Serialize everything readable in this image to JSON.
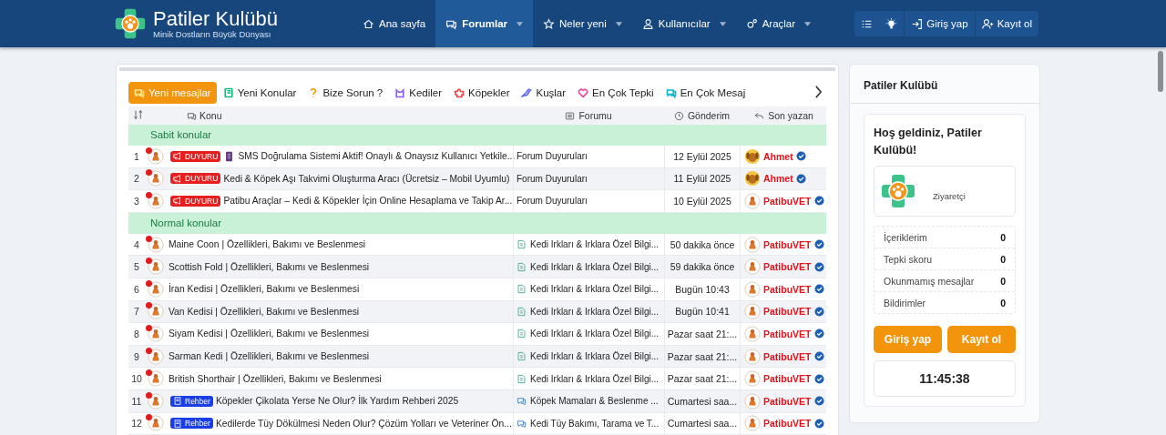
{
  "header": {
    "site_title": "Patiler Kulübü",
    "tagline": "Minik Dostların Büyük Dünyası",
    "nav": [
      {
        "label": "Ana sayfa",
        "selected": false,
        "dropdown": false
      },
      {
        "label": "Forumlar",
        "selected": true,
        "dropdown": true
      },
      {
        "label": "Neler yeni",
        "selected": false,
        "dropdown": true
      },
      {
        "label": "Kullanıcılar",
        "selected": false,
        "dropdown": true
      },
      {
        "label": "Araçlar",
        "selected": false,
        "dropdown": true
      }
    ],
    "actions": [
      "Giriş yap",
      "Kayıt ol"
    ]
  },
  "tabs": [
    {
      "label": "Yeni mesajlar",
      "color": "#fde68a",
      "selected": true
    },
    {
      "label": "Yeni Konular",
      "color": "#10b981",
      "selected": false
    },
    {
      "label": "Bize Sorun ?",
      "color": "#f59e0b",
      "selected": false
    },
    {
      "label": "Kediler",
      "color": "#8b5cf6",
      "selected": false
    },
    {
      "label": "Köpekler",
      "color": "#ef4444",
      "selected": false
    },
    {
      "label": "Kuşlar",
      "color": "#6366f1",
      "selected": false
    },
    {
      "label": "En Çok Tepki",
      "color": "#ec4899",
      "selected": false
    },
    {
      "label": "En Çok Mesaj",
      "color": "#06b6d4",
      "selected": false
    }
  ],
  "table": {
    "columns": [
      "Konu",
      "Forumu",
      "Gönderim",
      "Son yazan"
    ],
    "groups": [
      {
        "label": "Sabit konular",
        "rows": [
          {
            "kind": "announcement",
            "number": "1",
            "unread": true,
            "badge": {
              "kind": "duyuru",
              "label": "DUYURU"
            },
            "prefix_icon": true,
            "title": "SMS Doğrulama Sistemi Aktif! Onaylı & Onaysız Kullanıcı Yetkile...",
            "forum": "Forum Duyuruları",
            "date": "12 Eylül 2025",
            "author": "Ahmet",
            "avatar": {
              "kind": "dog"
            },
            "verified": true
          },
          {
            "kind": "announcement",
            "number": "2",
            "unread": true,
            "badge": {
              "kind": "duyuru",
              "label": "DUYURU"
            },
            "title": "Kedi & Köpek Aşı Takvimi Oluşturma Aracı (Ücretsiz – Mobil Uyumlu)",
            "forum": "Forum Duyuruları",
            "date": "11 Eylül 2025",
            "author": "Ahmet",
            "avatar": {
              "kind": "dog"
            },
            "verified": true
          },
          {
            "kind": "announcement",
            "number": "3",
            "unread": true,
            "badge": {
              "kind": "duyuru",
              "label": "DUYURU"
            },
            "title": "Patibu Araçlar – Kedi & Köpekler İçin Online Hesaplama ve Takip Ar...",
            "forum": "Forum Duyuruları",
            "date": "10 Eylül 2025",
            "author": "PatibuVET",
            "avatar": {
              "kind": "logo"
            },
            "verified": true
          }
        ]
      },
      {
        "label": "Normal konular",
        "rows": [
          {
            "kind": "article",
            "number": "4",
            "unread": true,
            "title": "Maine Coon | Özellikleri, Bakımı ve Beslenmesi",
            "forum": "Kedi Irkları & Irklara Özel Bilgi...",
            "date": "50 dakika önce",
            "author": "PatibuVET",
            "avatar": {
              "kind": "logo"
            },
            "verified": true
          },
          {
            "kind": "article",
            "number": "5",
            "unread": true,
            "title": "Scottish Fold | Özellikleri, Bakımı ve Beslenmesi",
            "forum": "Kedi Irkları & Irklara Özel Bilgi...",
            "date": "59 dakika önce",
            "author": "PatibuVET",
            "avatar": {
              "kind": "logo"
            },
            "verified": true
          },
          {
            "kind": "article",
            "number": "6",
            "unread": true,
            "title": "İran Kedisi | Özellikleri, Bakımı ve Beslenmesi",
            "forum": "Kedi Irkları & Irklara Özel Bilgi...",
            "date": "Bugün 10:43",
            "author": "PatibuVET",
            "avatar": {
              "kind": "logo"
            },
            "verified": true
          },
          {
            "kind": "article",
            "number": "7",
            "unread": true,
            "title": "Van Kedisi | Özellikleri, Bakımı ve Beslenmesi",
            "forum": "Kedi Irkları & Irklara Özel Bilgi...",
            "date": "Bugün 10:41",
            "author": "PatibuVET",
            "avatar": {
              "kind": "logo"
            },
            "verified": true
          },
          {
            "kind": "article",
            "number": "8",
            "unread": true,
            "title": "Siyam Kedisi | Özellikleri, Bakımı ve Beslenmesi",
            "forum": "Kedi Irkları & Irklara Özel Bilgi...",
            "date": "Pazar saat 21:...",
            "author": "PatibuVET",
            "avatar": {
              "kind": "logo"
            },
            "verified": true
          },
          {
            "kind": "article",
            "number": "9",
            "unread": true,
            "title": "Sarman Kedi | Özellikleri, Bakımı ve Beslenmesi",
            "forum": "Kedi Irkları & Irklara Özel Bilgi...",
            "date": "Pazar saat 21:...",
            "author": "PatibuVET",
            "avatar": {
              "kind": "logo"
            },
            "verified": true
          },
          {
            "kind": "article",
            "number": "10",
            "unread": true,
            "title": "British Shorthair | Özellikleri, Bakımı ve Beslenmesi",
            "forum": "Kedi Irkları & Irklara Özel Bilgi...",
            "date": "Pazar saat 21:...",
            "author": "PatibuVET",
            "avatar": {
              "kind": "logo"
            },
            "verified": true
          },
          {
            "kind": "discussion",
            "number": "11",
            "unread": true,
            "badge": {
              "kind": "rehber",
              "label": "Rehber"
            },
            "title": "Köpekler Çikolata Yerse Ne Olur? İlk Yardım Rehberi 2025",
            "forum": "Köpek Mamaları & Beslenme ...",
            "date": "Cumartesi saa...",
            "author": "PatibuVET",
            "avatar": {
              "kind": "logo"
            },
            "verified": true
          },
          {
            "kind": "discussion",
            "number": "12",
            "unread": true,
            "badge": {
              "kind": "rehber",
              "label": "Rehber"
            },
            "title": "Kedilerde Tüy Dökülmesi Neden Olur? Çözüm Yolları ve Veteriner Ön...",
            "forum": "Kedi Tüy Bakımı, Tarama ve T...",
            "date": "Cumartesi saa...",
            "author": "PatibuVET",
            "avatar": {
              "kind": "logo"
            },
            "verified": true
          }
        ]
      }
    ]
  },
  "sidebar": {
    "title": "Patiler Kulübü",
    "welcome": "Hoş geldiniz, Patiler Kulübü!",
    "role": "Ziyaretçi",
    "stats": [
      {
        "label": "İçeriklerim",
        "value": "0"
      },
      {
        "label": "Tepki skoru",
        "value": "0"
      },
      {
        "label": "Okunmamış mesajlar",
        "value": "0"
      },
      {
        "label": "Bildirimler",
        "value": "0"
      }
    ],
    "buttons": [
      "Giriş yap",
      "Kayıt ol"
    ],
    "clock": "11:45:38"
  }
}
